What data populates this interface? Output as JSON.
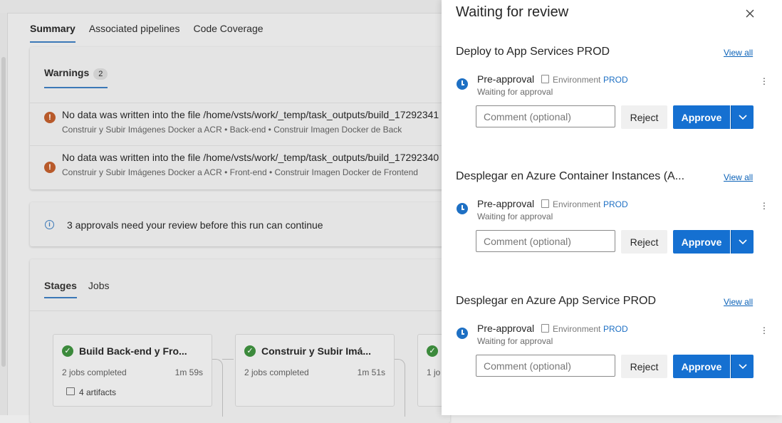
{
  "background": {
    "tabs": [
      {
        "label": "Summary"
      },
      {
        "label": "Associated pipelines"
      },
      {
        "label": "Code Coverage"
      }
    ],
    "warnings": {
      "title": "Warnings",
      "count": "2",
      "items": [
        {
          "message": "No data was written into the file /home/vsts/work/_temp/task_outputs/build_17292341",
          "detail": "Construir y Subir Imágenes Docker a ACR • Back-end • Construir Imagen Docker de Back"
        },
        {
          "message": "No data was written into the file /home/vsts/work/_temp/task_outputs/build_17292340",
          "detail": "Construir y Subir Imágenes Docker a ACR • Front-end • Construir Imagen Docker de Frontend"
        }
      ]
    },
    "info_banner": "3 approvals need your review before this run can continue",
    "stages_tabs": [
      {
        "label": "Stages"
      },
      {
        "label": "Jobs"
      }
    ],
    "stages": [
      {
        "name": "Build Back-end y Fro...",
        "jobs": "2 jobs completed",
        "time": "1m 59s",
        "artifacts": "4 artifacts"
      },
      {
        "name": "Construir y Subir Imá...",
        "jobs": "2 jobs completed",
        "time": "1m 51s",
        "artifacts": ""
      },
      {
        "name": "",
        "jobs": "1 jo",
        "time": "",
        "artifacts": ""
      }
    ]
  },
  "panel": {
    "title": "Waiting for review",
    "sections": [
      {
        "name": "Deploy to App Services PROD",
        "view_all": "View all",
        "check": "Pre-approval",
        "env_label": "Environment",
        "env_value": "PROD",
        "status": "Waiting for approval",
        "comment_placeholder": "Comment (optional)",
        "reject": "Reject",
        "approve": "Approve"
      },
      {
        "name": "Desplegar en Azure Container Instances (A...",
        "view_all": "View all",
        "check": "Pre-approval",
        "env_label": "Environment",
        "env_value": "PROD",
        "status": "Waiting for approval",
        "comment_placeholder": "Comment (optional)",
        "reject": "Reject",
        "approve": "Approve"
      },
      {
        "name": "Desplegar en Azure App Service PROD",
        "view_all": "View all",
        "check": "Pre-approval",
        "env_label": "Environment",
        "env_value": "PROD",
        "status": "Waiting for approval",
        "comment_placeholder": "Comment (optional)",
        "reject": "Reject",
        "approve": "Approve"
      }
    ]
  },
  "colors": {
    "accent": "#1570d1",
    "success": "#3c8a3c",
    "warning": "#b85a2b",
    "link": "#0b62b8"
  },
  "icons": {
    "warning": "warning-circle-icon",
    "info": "info-icon",
    "success": "check-circle-icon",
    "clock": "clock-icon",
    "close": "close-icon",
    "environment": "environment-icon",
    "more": "more-vertical-icon",
    "dropdown": "chevron-down-icon"
  }
}
